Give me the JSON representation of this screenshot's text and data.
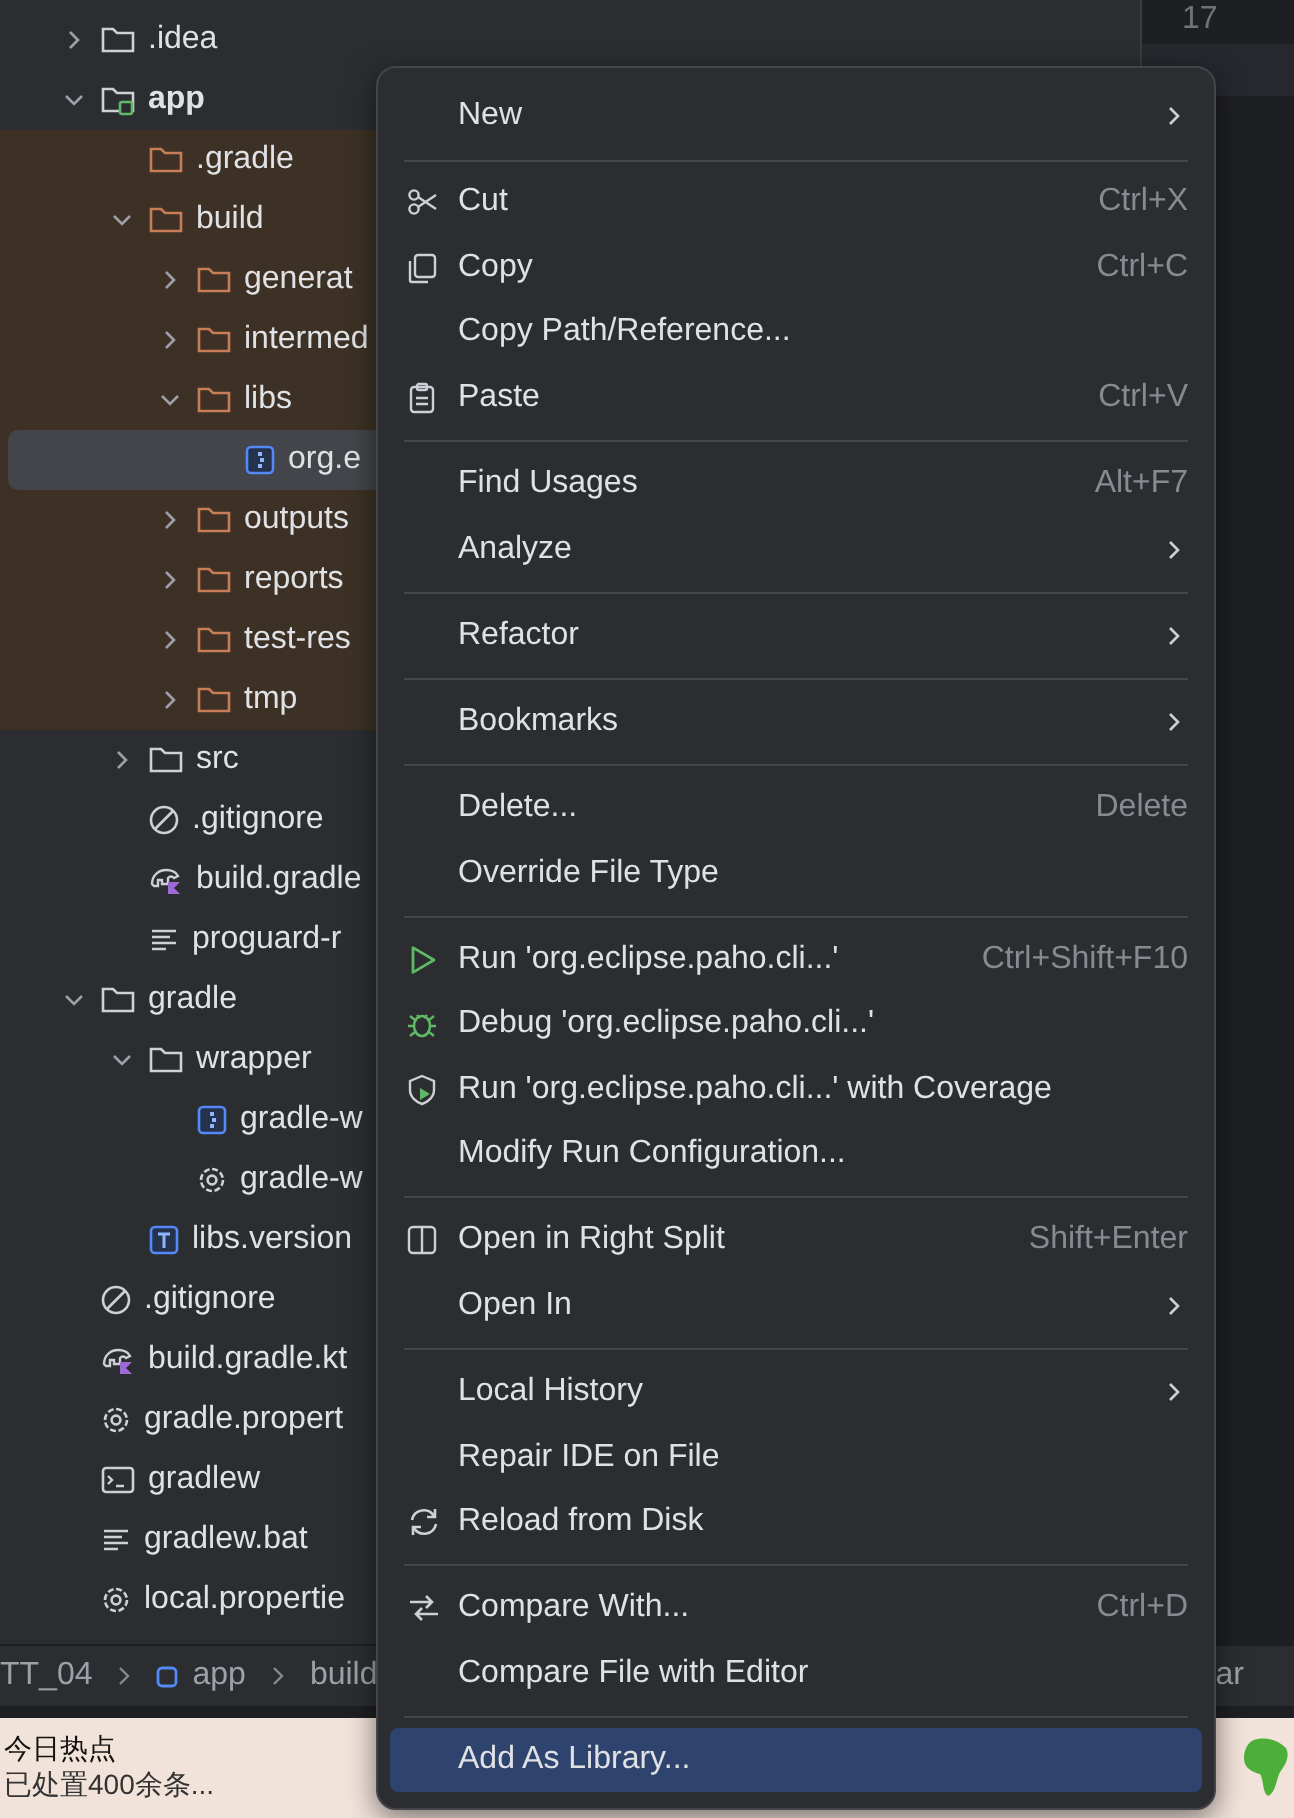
{
  "project_tree": [
    {
      "label": ".idea",
      "kind": "folder",
      "expanded": false,
      "excluded": false,
      "selected": false
    },
    {
      "label": "app",
      "kind": "module",
      "expanded": true,
      "excluded": false,
      "selected": false,
      "children": [
        {
          "label": ".gradle",
          "kind": "folder",
          "excluded": true,
          "selected": false
        },
        {
          "label": "build",
          "kind": "folder",
          "expanded": true,
          "excluded": true,
          "selected": false,
          "children": [
            {
              "label": "generat",
              "kind": "folder",
              "expanded": false,
              "excluded": true,
              "selected": false
            },
            {
              "label": "intermed",
              "kind": "folder",
              "expanded": false,
              "excluded": true,
              "selected": false
            },
            {
              "label": "libs",
              "kind": "folder",
              "expanded": true,
              "excluded": true,
              "selected": false,
              "children": [
                {
                  "label": "org.e",
                  "kind": "jar",
                  "excluded": true,
                  "selected": true
                }
              ]
            },
            {
              "label": "outputs",
              "kind": "folder",
              "expanded": false,
              "excluded": true,
              "selected": false
            },
            {
              "label": "reports",
              "kind": "folder",
              "expanded": false,
              "excluded": true,
              "selected": false
            },
            {
              "label": "test-res",
              "kind": "folder",
              "expanded": false,
              "excluded": true,
              "selected": false
            },
            {
              "label": "tmp",
              "kind": "folder",
              "expanded": false,
              "excluded": true,
              "selected": false
            }
          ]
        },
        {
          "label": "src",
          "kind": "folder",
          "expanded": false,
          "excluded": false,
          "selected": false
        },
        {
          "label": ".gitignore",
          "kind": "gitignore",
          "excluded": false,
          "selected": false
        },
        {
          "label": "build.gradle",
          "kind": "gradle-script",
          "excluded": false,
          "selected": false
        },
        {
          "label": "proguard-r",
          "kind": "text",
          "excluded": false,
          "selected": false
        }
      ]
    },
    {
      "label": "gradle",
      "kind": "folder",
      "expanded": true,
      "excluded": false,
      "selected": false,
      "children": [
        {
          "label": "wrapper",
          "kind": "folder",
          "expanded": true,
          "excluded": false,
          "selected": false,
          "children": [
            {
              "label": "gradle-w",
              "kind": "jar",
              "excluded": false,
              "selected": false
            },
            {
              "label": "gradle-w",
              "kind": "settings",
              "excluded": false,
              "selected": false
            }
          ]
        },
        {
          "label": "libs.version",
          "kind": "toml",
          "excluded": false,
          "selected": false
        }
      ]
    },
    {
      "label": ".gitignore",
      "kind": "gitignore",
      "excluded": false,
      "selected": false
    },
    {
      "label": "build.gradle.kt",
      "kind": "gradle-script",
      "excluded": false,
      "selected": false
    },
    {
      "label": "gradle.propert",
      "kind": "settings",
      "excluded": false,
      "selected": false
    },
    {
      "label": "gradlew",
      "kind": "terminal",
      "excluded": false,
      "selected": false
    },
    {
      "label": "gradlew.bat",
      "kind": "text",
      "excluded": false,
      "selected": false
    },
    {
      "label": "local.propertie",
      "kind": "settings",
      "excluded": false,
      "selected": false
    }
  ],
  "editor": {
    "line_numbers": [
      "17"
    ]
  },
  "breadcrumbs": [
    {
      "label": "TT_04",
      "kind": "text"
    },
    {
      "label": "app",
      "kind": "module"
    },
    {
      "label": "build",
      "kind": "text"
    }
  ],
  "breadcrumbs_right": "ar",
  "notification": {
    "title": "今日热点",
    "text": "已处置400余条..."
  },
  "context_menu": [
    {
      "kind": "plain",
      "label": "New",
      "submenu": true,
      "selected": false
    },
    {
      "kind": "separator"
    },
    {
      "kind": "cut",
      "label": "Cut",
      "shortcut": "Ctrl+X",
      "selected": false
    },
    {
      "kind": "copy",
      "label": "Copy",
      "shortcut": "Ctrl+C",
      "selected": false
    },
    {
      "kind": "plain",
      "label": "Copy Path/Reference...",
      "selected": false
    },
    {
      "kind": "paste",
      "label": "Paste",
      "shortcut": "Ctrl+V",
      "selected": false
    },
    {
      "kind": "separator"
    },
    {
      "kind": "plain",
      "label": "Find Usages",
      "shortcut": "Alt+F7",
      "selected": false
    },
    {
      "kind": "plain",
      "label": "Analyze",
      "submenu": true,
      "selected": false
    },
    {
      "kind": "separator"
    },
    {
      "kind": "plain",
      "label": "Refactor",
      "submenu": true,
      "selected": false
    },
    {
      "kind": "separator"
    },
    {
      "kind": "plain",
      "label": "Bookmarks",
      "submenu": true,
      "selected": false
    },
    {
      "kind": "separator"
    },
    {
      "kind": "plain",
      "label": "Delete...",
      "shortcut": "Delete",
      "selected": false
    },
    {
      "kind": "plain",
      "label": "Override File Type",
      "selected": false
    },
    {
      "kind": "separator"
    },
    {
      "kind": "run",
      "label": "Run 'org.eclipse.paho.cli...'",
      "shortcut": "Ctrl+Shift+F10",
      "selected": false
    },
    {
      "kind": "debug",
      "label": "Debug 'org.eclipse.paho.cli...'",
      "selected": false
    },
    {
      "kind": "coverage",
      "label": "Run 'org.eclipse.paho.cli...' with Coverage",
      "selected": false
    },
    {
      "kind": "plain",
      "label": "Modify Run Configuration...",
      "selected": false
    },
    {
      "kind": "separator"
    },
    {
      "kind": "split",
      "label": "Open in Right Split",
      "shortcut": "Shift+Enter",
      "selected": false
    },
    {
      "kind": "plain",
      "label": "Open In",
      "submenu": true,
      "selected": false
    },
    {
      "kind": "separator"
    },
    {
      "kind": "plain",
      "label": "Local History",
      "submenu": true,
      "selected": false
    },
    {
      "kind": "plain",
      "label": "Repair IDE on File",
      "selected": false
    },
    {
      "kind": "reload",
      "label": "Reload from Disk",
      "selected": false
    },
    {
      "kind": "separator"
    },
    {
      "kind": "compare",
      "label": "Compare With...",
      "shortcut": "Ctrl+D",
      "selected": false
    },
    {
      "kind": "plain",
      "label": "Compare File with Editor",
      "selected": false
    },
    {
      "kind": "separator"
    },
    {
      "kind": "plain",
      "label": "Add As Library...",
      "selected": true
    }
  ]
}
